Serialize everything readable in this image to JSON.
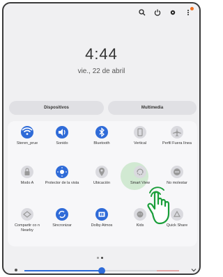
{
  "clock": {
    "time": "4:44",
    "date": "vie., 22 de abril"
  },
  "topbar": {
    "icons": [
      "search-icon",
      "power-icon",
      "settings-icon",
      "more-icon"
    ],
    "notification_color": "#f07020"
  },
  "tabs": {
    "devices": "Dispositivos",
    "media": "Multimedia"
  },
  "tiles": [
    {
      "label": "Steren_prue",
      "icon": "wifi-icon",
      "state": "on"
    },
    {
      "label": "Sonido",
      "icon": "sound-icon",
      "state": "on"
    },
    {
      "label": "Bluetooth",
      "icon": "bluetooth-icon",
      "state": "on"
    },
    {
      "label": "Vertical",
      "icon": "rotation-icon",
      "state": "off"
    },
    {
      "label": "Perfil Fuera línea",
      "icon": "airplane-icon",
      "state": "off"
    },
    {
      "label": "Modo A",
      "icon": "lock-icon",
      "state": "off"
    },
    {
      "label": "Protector de la vista",
      "icon": "eye-comfort-icon",
      "state": "on"
    },
    {
      "label": "Ubicación",
      "icon": "location-icon",
      "state": "off"
    },
    {
      "label": "Smart View",
      "icon": "smart-view-icon",
      "state": "off"
    },
    {
      "label": "No molestar",
      "icon": "do-not-disturb-icon",
      "state": "off"
    },
    {
      "label": "Compartir co n Nearby",
      "icon": "nearby-share-icon",
      "state": "off"
    },
    {
      "label": "Sincronizar",
      "icon": "sync-icon",
      "state": "on"
    },
    {
      "label": "Dolby Atmos",
      "icon": "dolby-icon",
      "state": "on"
    },
    {
      "label": "Kids",
      "icon": "kids-icon",
      "state": "off"
    },
    {
      "label": "Quick Share",
      "icon": "quick-share-icon",
      "state": "off"
    }
  ],
  "brightness": {
    "level": 0.5
  },
  "page_indicator": {
    "current": 2,
    "total": 2
  },
  "colors": {
    "accent": "#2f6bd8",
    "highlight": "#b8e0b8",
    "gesture": "#1a9e3a"
  }
}
